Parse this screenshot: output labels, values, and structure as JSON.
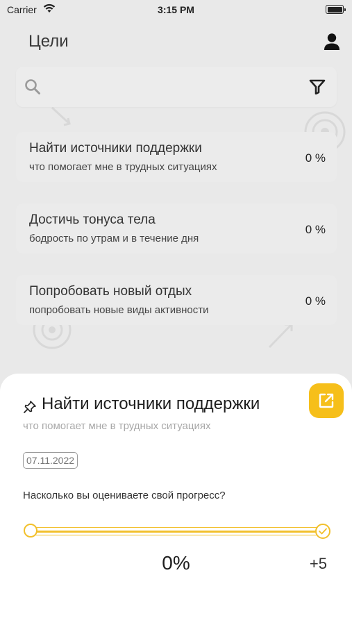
{
  "status_bar": {
    "carrier": "Carrier",
    "time": "3:15 PM"
  },
  "header": {
    "title": "Цели",
    "profile_icon": "person-icon"
  },
  "search": {
    "value": "",
    "placeholder": "",
    "search_icon": "search-icon",
    "filter_icon": "filter-icon"
  },
  "goals": [
    {
      "title": "Найти источники поддержки",
      "subtitle": "что помогает мне в трудных ситуациях",
      "progress": "0 %"
    },
    {
      "title": "Достичь тонуса тела",
      "subtitle": "бодрость по утрам и в течение дня",
      "progress": "0 %"
    },
    {
      "title": "Попробовать новый отдых",
      "subtitle": "попробовать новые виды активности",
      "progress": "0 %"
    }
  ],
  "sheet": {
    "pin_icon": "pin-icon",
    "title": "Найти источники поддержки",
    "subtitle": "что помогает мне в трудных ситуациях",
    "open_icon": "external-link-icon",
    "date": "07.11.2022",
    "question": "Насколько вы оцениваете свой прогресс?",
    "slider": {
      "min": 0,
      "max": 5,
      "value": 0
    },
    "current_value": "0%",
    "max_label": "+5"
  },
  "colors": {
    "accent": "#F6BF1A",
    "overlay": "#E9E9E9",
    "sheet_bg": "#FFFFFF",
    "track": "#F2C02C"
  }
}
